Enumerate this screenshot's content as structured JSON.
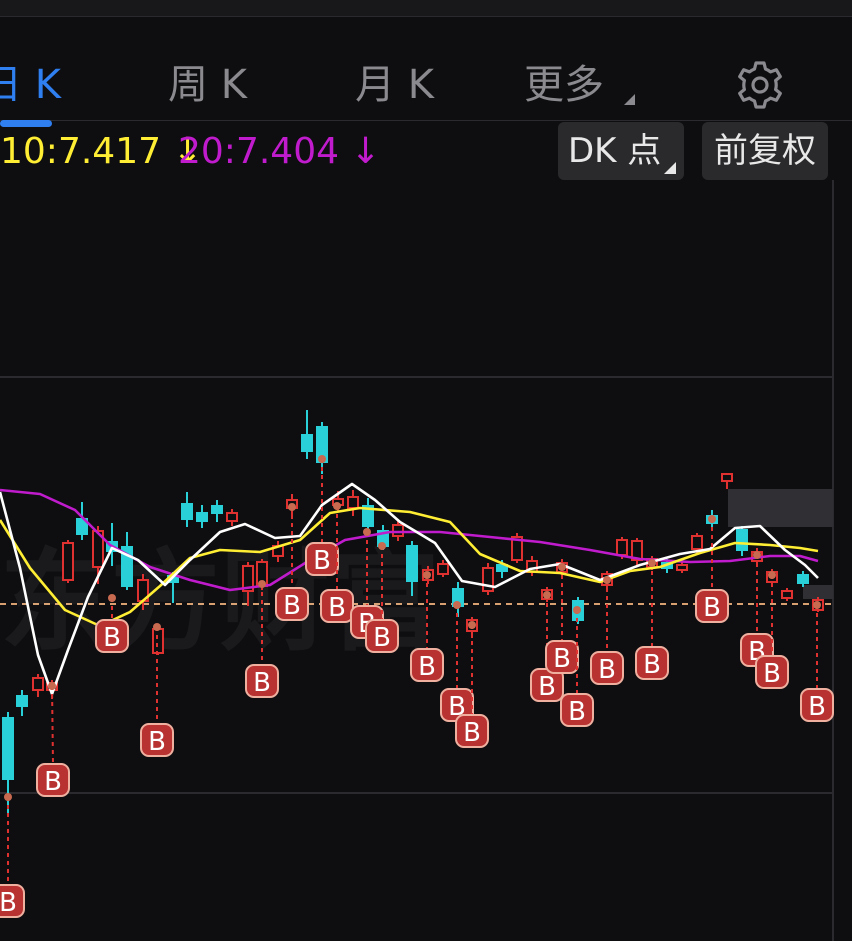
{
  "tabs": {
    "day": "日 K",
    "week": "周 K",
    "month": "月 K",
    "more": "更多"
  },
  "ma": {
    "ma10": "10:7.417 ↓",
    "ma20": "20:7.404 ↓"
  },
  "controls": {
    "dk": "DK 点",
    "fq": "前复权"
  },
  "watermark": "东方财富",
  "markers": {
    "buy": "B"
  },
  "colors": {
    "up": "#e03131",
    "down": "#29d0d8",
    "ma5": "#ffffff",
    "ma10": "#ffee33",
    "ma20": "#c01bcc",
    "accent": "#2f7ff0",
    "price_line": "#d8a070"
  },
  "icons": {
    "settings": "gear-icon",
    "more": "caret-icon",
    "dk": "caret-icon"
  }
}
